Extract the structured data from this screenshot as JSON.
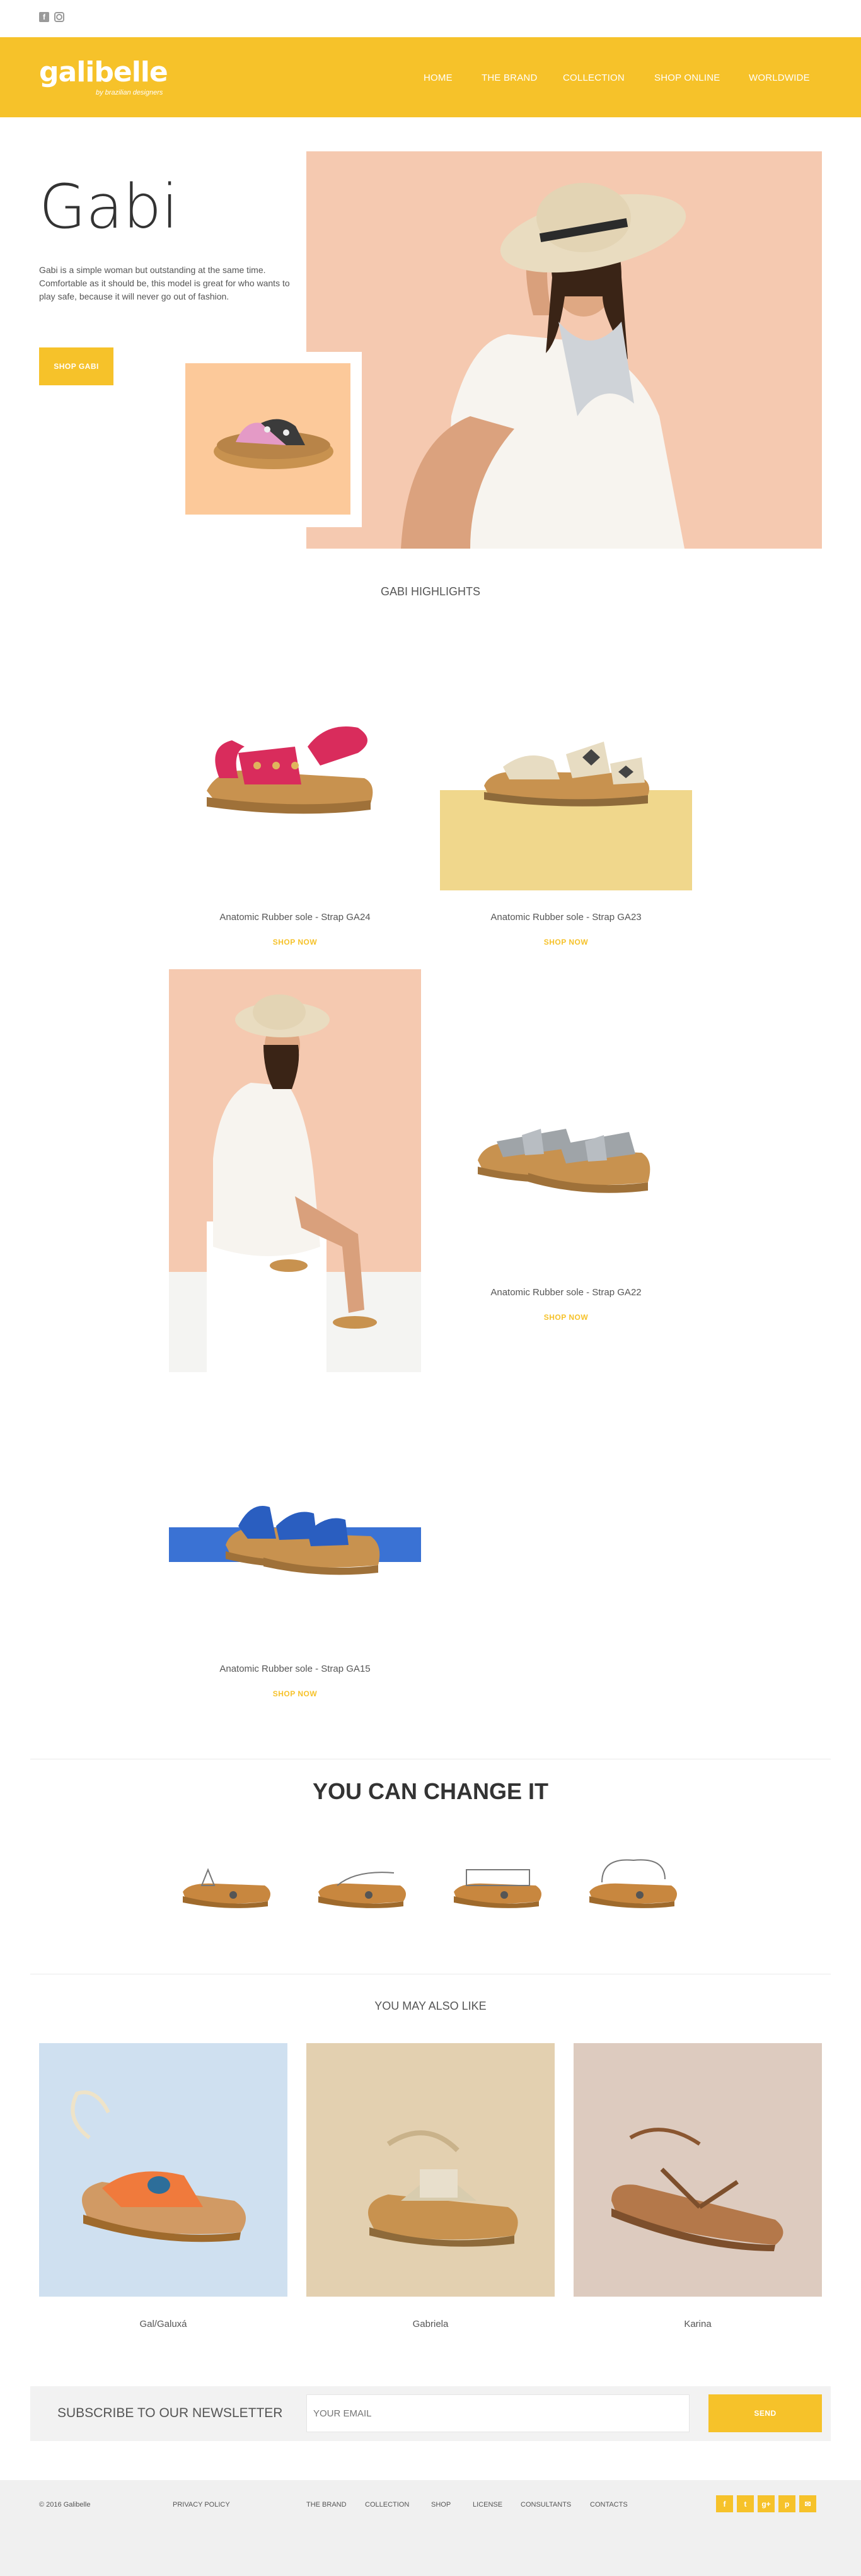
{
  "social_top": {
    "facebook": "f"
  },
  "brand": {
    "name": "galibelle",
    "tagline": "by brazilian designers"
  },
  "nav": [
    "HOME",
    "THE BRAND",
    "COLLECTION",
    "SHOP ONLINE",
    "WORLDWIDE"
  ],
  "hero": {
    "title": "Gabi",
    "description": "Gabi is a simple woman but outstanding at the same time. Comfortable as it should be, this model is great for who wants to play safe, because it will never go out of fashion.",
    "button": "SHOP GABI"
  },
  "highlights": {
    "title": "GABI HIGHLIGHTS",
    "products": [
      {
        "label": "Anatomic Rubber sole - Strap GA24",
        "cta": "SHOP NOW"
      },
      {
        "label": "Anatomic Rubber sole - Strap GA23",
        "cta": "SHOP NOW"
      },
      {
        "label": "Anatomic Rubber sole - Strap GA22",
        "cta": "SHOP NOW"
      },
      {
        "label": "Anatomic Rubber sole - Strap GA15",
        "cta": "SHOP NOW"
      }
    ]
  },
  "change": {
    "title": "YOU CAN CHANGE IT"
  },
  "also_like": {
    "title": "YOU MAY ALSO LIKE",
    "items": [
      {
        "name": "Gal/Galuxá",
        "bg": "#cfe0f0"
      },
      {
        "name": "Gabriela",
        "bg": "#e3d0b0"
      },
      {
        "name": "Karina",
        "bg": "#ddcbbf"
      }
    ]
  },
  "newsletter": {
    "label": "SUBSCRIBE TO OUR NEWSLETTER",
    "placeholder": "YOUR EMAIL",
    "button": "SEND"
  },
  "footer": {
    "copyright": "© 2016 Galibelle",
    "privacy": "PRIVACY POLICY",
    "links": [
      "THE BRAND",
      "COLLECTION",
      "SHOP",
      "LICENSE",
      "CONSULTANTS",
      "CONTACTS"
    ],
    "icons": [
      "f",
      "t",
      "g+",
      "p",
      "✉"
    ]
  },
  "colors": {
    "accent": "#f6c22a",
    "peach": "#f5c9b0",
    "yellow_block": "#f0d78c",
    "blue_block": "#3a72d4"
  }
}
